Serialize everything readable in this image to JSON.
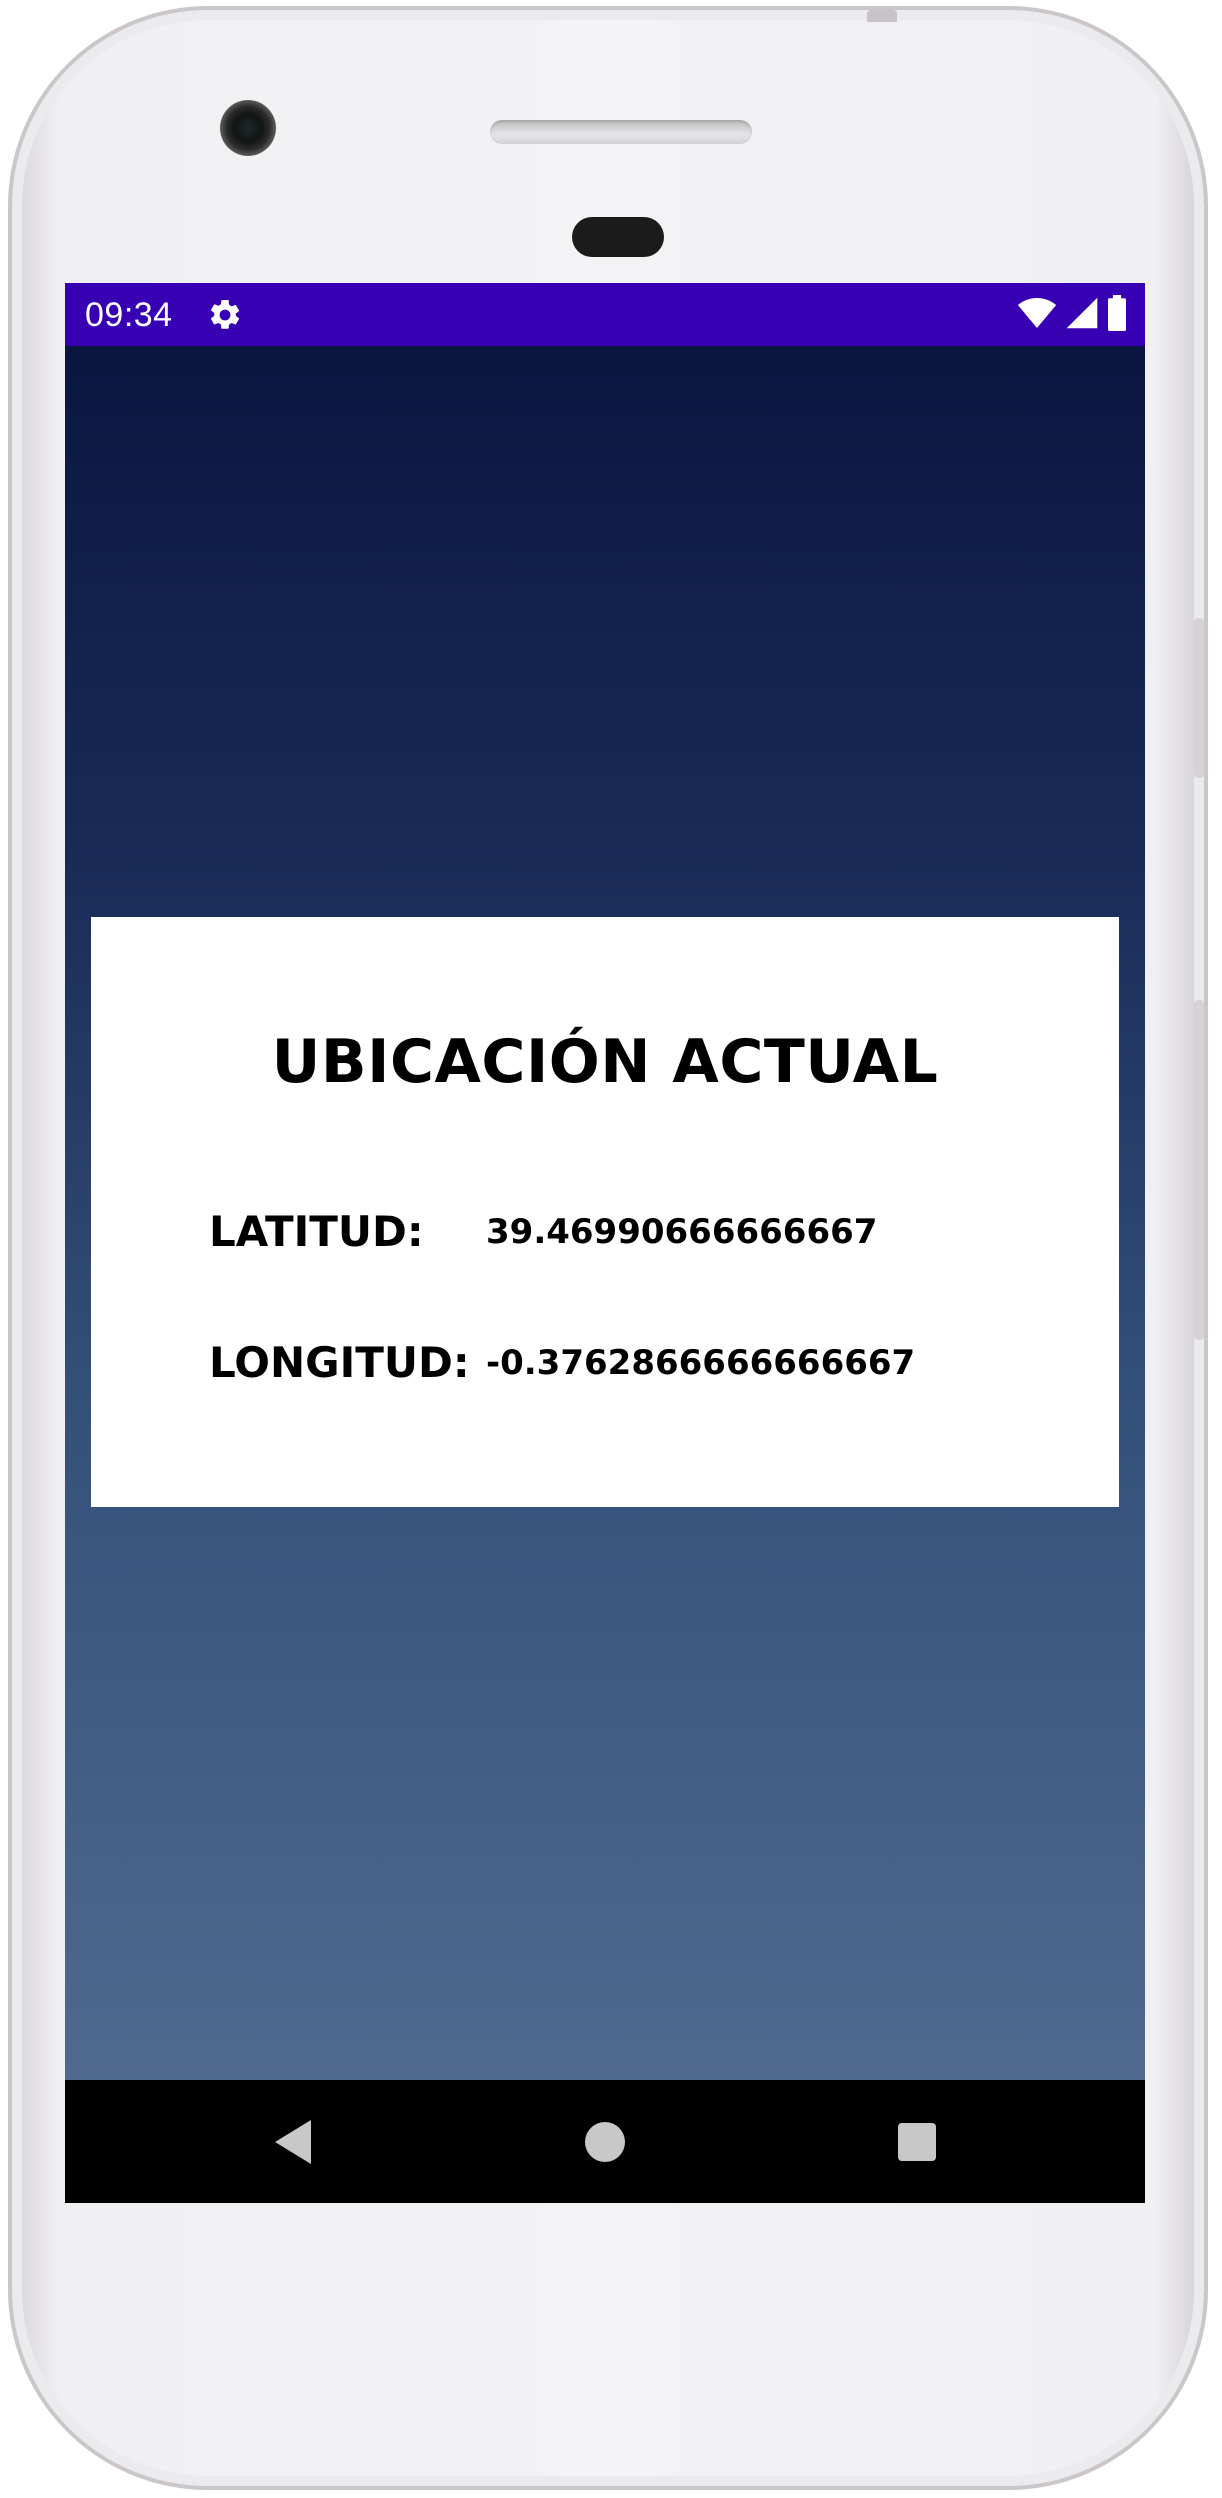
{
  "status_bar": {
    "time": "09:34",
    "icons": [
      "gear-icon",
      "wifi-icon",
      "cellular-signal-icon",
      "battery-icon"
    ],
    "background_color": "#3700b3"
  },
  "location_card": {
    "title": "UBICACIÓN ACTUAL",
    "latitude_label": "LATITUD:",
    "latitude_value": "39.46990666666667",
    "longitude_label": "LONGITUD:",
    "longitude_value": "-0.3762866666666667"
  },
  "navigation_bar": {
    "buttons": [
      "back-icon",
      "home-icon",
      "recents-icon"
    ]
  },
  "colors": {
    "gradient_top": "#0a1640",
    "gradient_bottom": "#50698f",
    "card_background": "#ffffff"
  }
}
